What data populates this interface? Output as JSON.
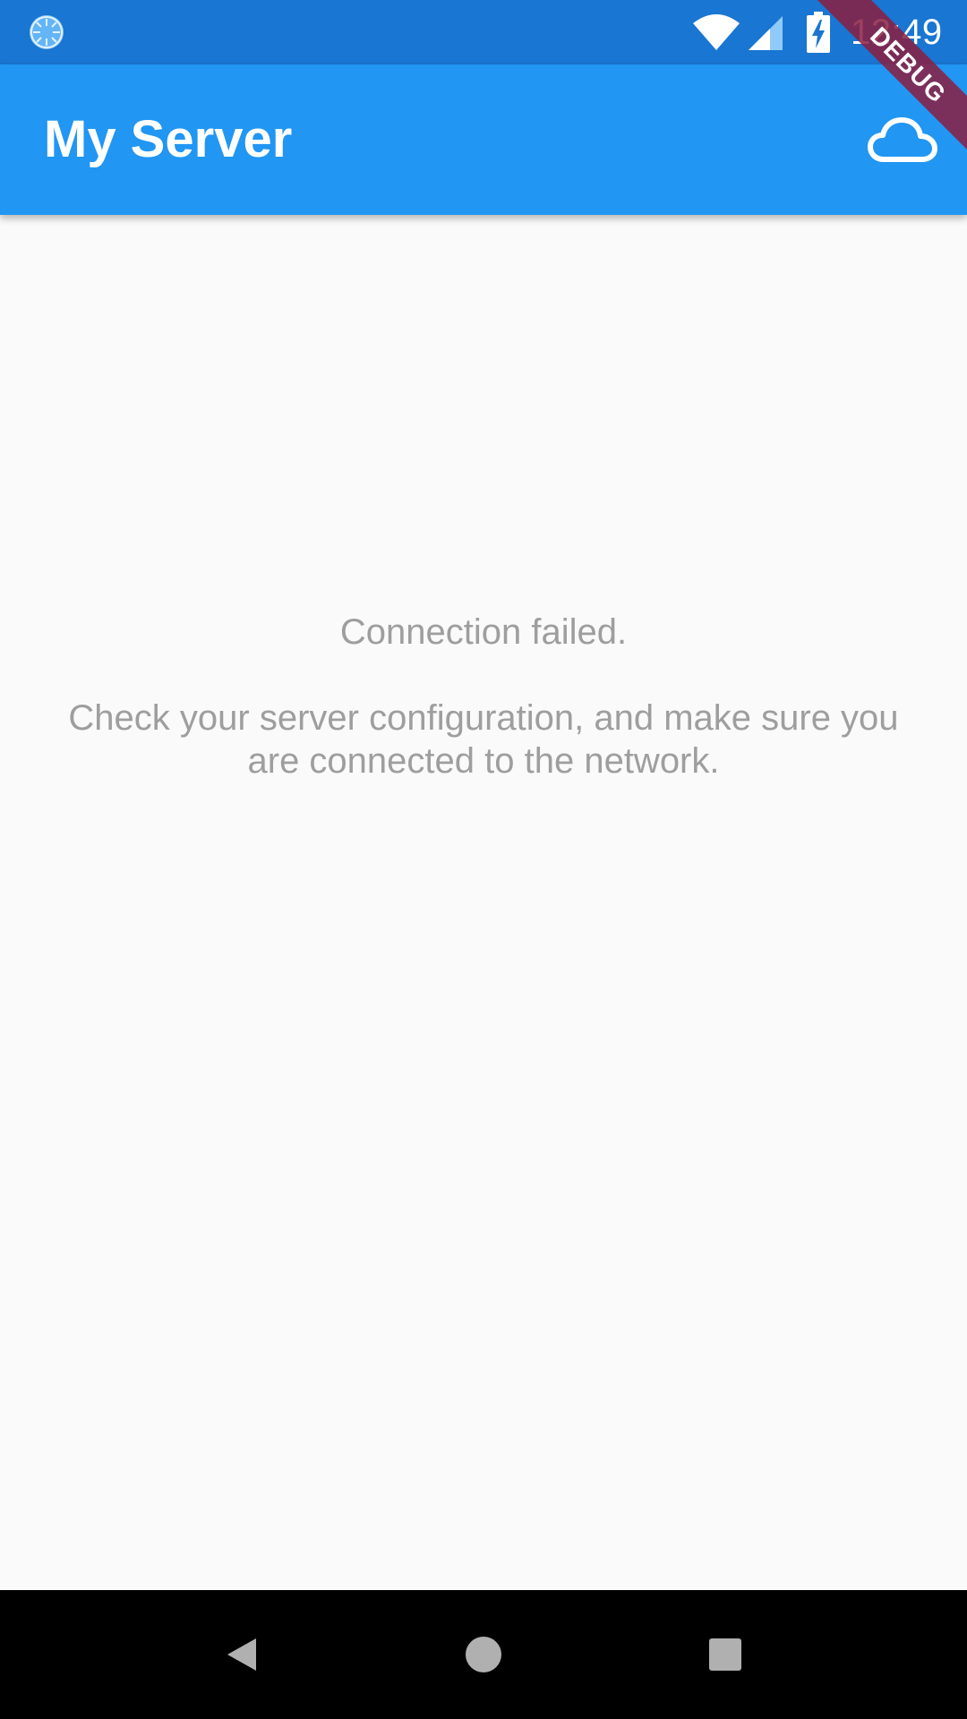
{
  "status_bar": {
    "time": "12:49",
    "icons": [
      "app-spinner-icon",
      "wifi-icon",
      "signal-icon",
      "battery-charging-icon"
    ]
  },
  "app_bar": {
    "title": "My Server",
    "action_icon": "cloud-icon",
    "background_color": "#2196f3",
    "status_bar_color": "#1976d2"
  },
  "content": {
    "title": "Connection failed.",
    "detail": "Check your server configuration, and make sure you are connected to the network.",
    "text_color": "#9e9e9e"
  },
  "debug_banner": {
    "label": "DEBUG",
    "color": "#8b1f3f"
  },
  "nav_bar": {
    "icons": [
      "back-icon",
      "home-icon",
      "recents-icon"
    ]
  }
}
